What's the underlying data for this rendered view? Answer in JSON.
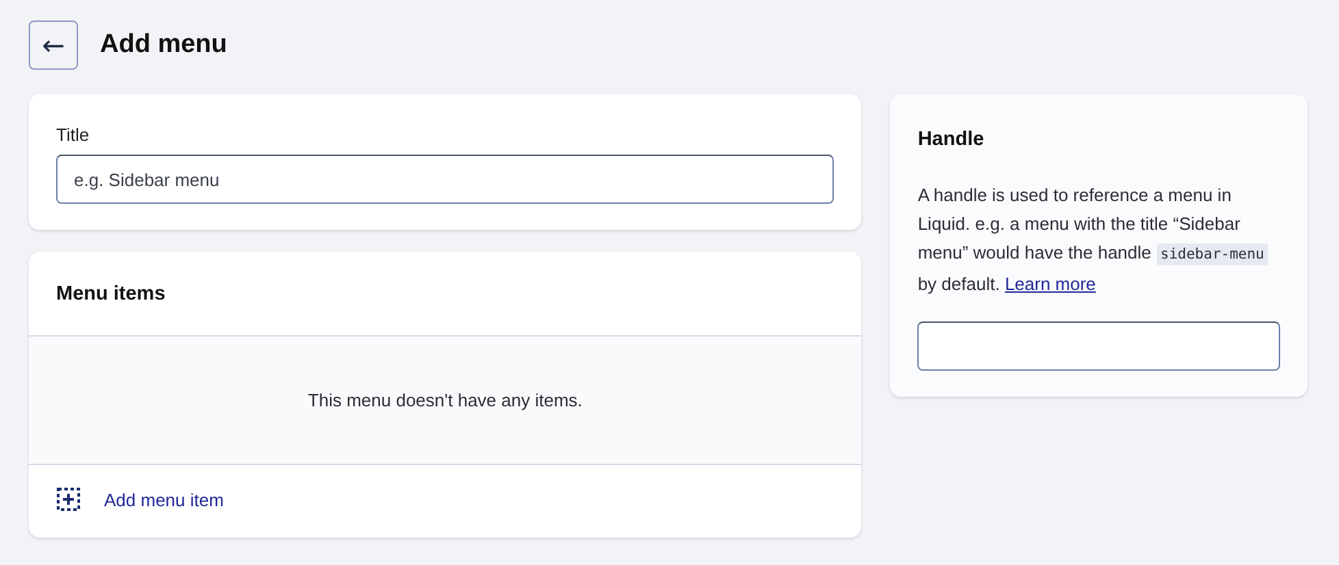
{
  "header": {
    "back_button": "←",
    "title": "Add menu"
  },
  "title_card": {
    "label": "Title",
    "placeholder": "e.g. Sidebar menu"
  },
  "menu_items_card": {
    "heading": "Menu items",
    "empty_message": "This menu doesn't have any items.",
    "add_link": "Add menu item"
  },
  "handle_card": {
    "heading": "Handle",
    "description": [
      {
        "kind": "text",
        "text": "A handle is used to reference a menu in Liquid. e.g. a menu with the title “Sidebar menu” would have the handle "
      },
      {
        "kind": "code",
        "text": "sidebar-menu"
      },
      {
        "kind": "text",
        "text": " by default. "
      },
      {
        "kind": "link",
        "text": "Learn more"
      }
    ]
  }
}
